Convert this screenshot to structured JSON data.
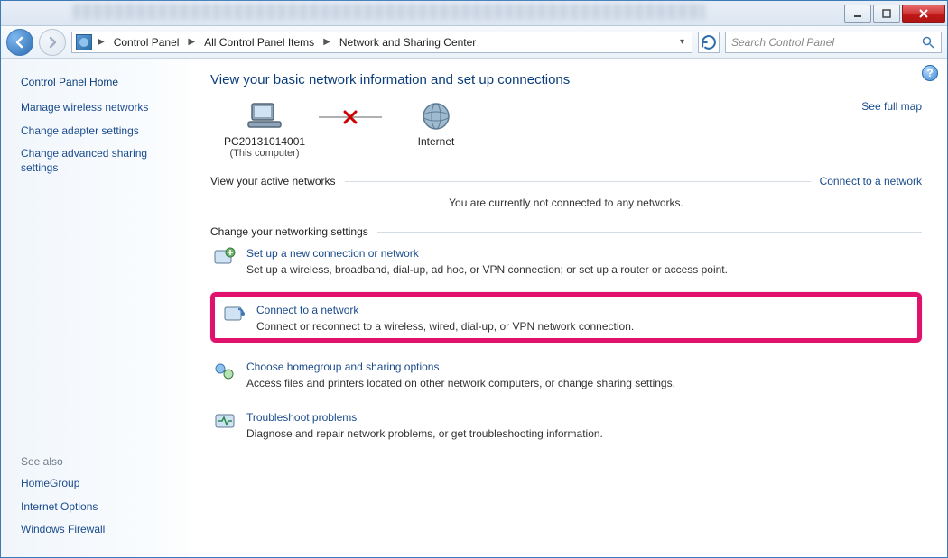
{
  "breadcrumb": {
    "root": "Control Panel",
    "mid": "All Control Panel Items",
    "leaf": "Network and Sharing Center"
  },
  "search": {
    "placeholder": "Search Control Panel"
  },
  "sidebar": {
    "home": "Control Panel Home",
    "links": [
      "Manage wireless networks",
      "Change adapter settings",
      "Change advanced sharing settings"
    ],
    "see_also_label": "See also",
    "see_also": [
      "HomeGroup",
      "Internet Options",
      "Windows Firewall"
    ]
  },
  "page": {
    "title": "View your basic network information and set up connections",
    "map": {
      "computer_name": "PC20131014001",
      "computer_sub": "(This computer)",
      "internet_label": "Internet",
      "full_map": "See full map"
    },
    "active_networks": {
      "heading": "View your active networks",
      "connect_link": "Connect to a network",
      "none_msg": "You are currently not connected to any networks."
    },
    "change_heading": "Change your networking settings",
    "settings": [
      {
        "title": "Set up a new connection or network",
        "desc": "Set up a wireless, broadband, dial-up, ad hoc, or VPN connection; or set up a router or access point."
      },
      {
        "title": "Connect to a network",
        "desc": "Connect or reconnect to a wireless, wired, dial-up, or VPN network connection."
      },
      {
        "title": "Choose homegroup and sharing options",
        "desc": "Access files and printers located on other network computers, or change sharing settings."
      },
      {
        "title": "Troubleshoot problems",
        "desc": "Diagnose and repair network problems, or get troubleshooting information."
      }
    ]
  }
}
